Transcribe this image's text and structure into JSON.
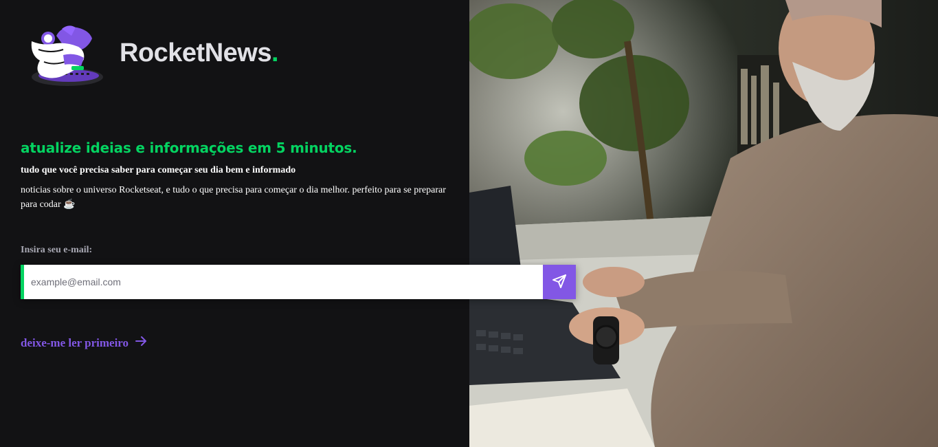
{
  "brand": {
    "name": "RocketNews",
    "dot": "."
  },
  "hero": {
    "headline": "atualize ideias e informações em 5 minutos.",
    "subheadline": "tudo que você precisa saber para começar seu dia bem e informado",
    "description": "noticias sobre o universo Rocketseat, e tudo o que precisa para começar o dia melhor. perfeito para se preparar para codar ☕"
  },
  "form": {
    "email_label": "Insira seu e-mail:",
    "email_placeholder": "example@email.com",
    "email_value": "",
    "submit_icon": "send-icon"
  },
  "link": {
    "label": "deixe-me ler primeiro",
    "icon": "arrow-right-icon"
  },
  "photo": {
    "subject": "man-typing-on-laptop-photo"
  },
  "colors": {
    "background": "#121214",
    "brand_green": "#04d361",
    "accent_purple": "#8257e5",
    "text_white": "#ffffff",
    "text_muted": "#a8a8b3"
  }
}
